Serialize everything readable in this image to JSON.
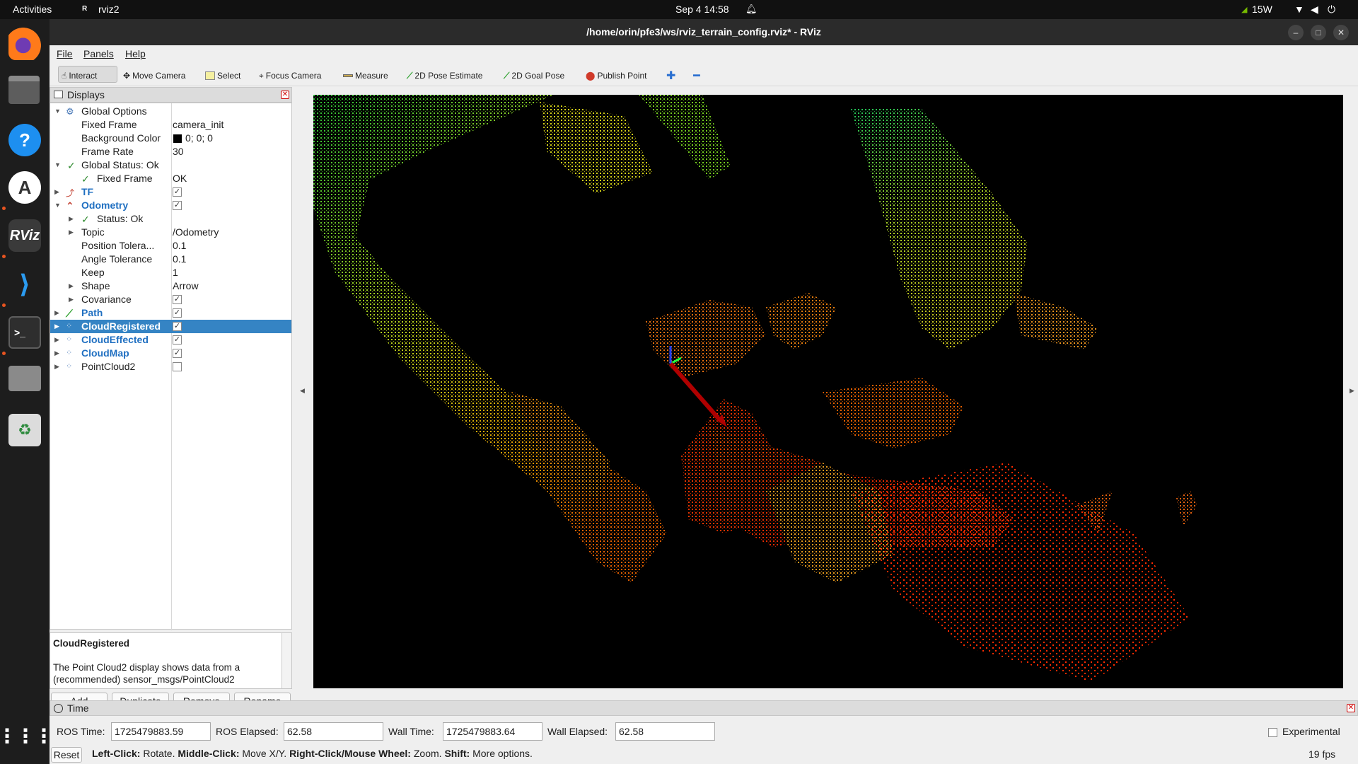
{
  "topbar": {
    "activities": "Activities",
    "app": "rviz2",
    "datetime": "Sep 4  14:58",
    "power": "15W"
  },
  "window": {
    "title": "/home/orin/pfe3/ws/rviz_terrain_config.rviz* - RViz"
  },
  "menu": {
    "file": "File",
    "panels": "Panels",
    "help": "Help"
  },
  "toolbar": {
    "interact": "Interact",
    "move_camera": "Move Camera",
    "select": "Select",
    "focus_camera": "Focus Camera",
    "measure": "Measure",
    "pose_estimate": "2D Pose Estimate",
    "goal_pose": "2D Goal Pose",
    "publish_point": "Publish Point"
  },
  "displays": {
    "title": "Displays",
    "rows": [
      {
        "label": "Global Options",
        "value": ""
      },
      {
        "label": "Fixed Frame",
        "value": "camera_init"
      },
      {
        "label": "Background Color",
        "value": "0; 0; 0"
      },
      {
        "label": "Frame Rate",
        "value": "30"
      },
      {
        "label": "Global Status: Ok",
        "value": ""
      },
      {
        "label": "Fixed Frame",
        "value": "OK"
      },
      {
        "label": "TF",
        "value": ""
      },
      {
        "label": "Odometry",
        "value": ""
      },
      {
        "label": "Status: Ok",
        "value": ""
      },
      {
        "label": "Topic",
        "value": "/Odometry"
      },
      {
        "label": "Position Tolera...",
        "value": "0.1"
      },
      {
        "label": "Angle Tolerance",
        "value": "0.1"
      },
      {
        "label": "Keep",
        "value": "1"
      },
      {
        "label": "Shape",
        "value": "Arrow"
      },
      {
        "label": "Covariance",
        "value": ""
      },
      {
        "label": "Path",
        "value": ""
      },
      {
        "label": "CloudRegistered",
        "value": ""
      },
      {
        "label": "CloudEffected",
        "value": ""
      },
      {
        "label": "CloudMap",
        "value": ""
      },
      {
        "label": "PointCloud2",
        "value": ""
      }
    ],
    "description_title": "CloudRegistered",
    "description_text": "The Point Cloud2 display shows data from a (recommended) sensor_msgs/PointCloud2",
    "buttons": {
      "add": "Add",
      "duplicate": "Duplicate",
      "remove": "Remove",
      "rename": "Rename"
    }
  },
  "time": {
    "title": "Time",
    "ros_time_label": "ROS Time:",
    "ros_time": "1725479883.59",
    "ros_elapsed_label": "ROS Elapsed:",
    "ros_elapsed": "62.58",
    "wall_time_label": "Wall Time:",
    "wall_time": "1725479883.64",
    "wall_elapsed_label": "Wall Elapsed:",
    "wall_elapsed": "62.58",
    "experimental": "Experimental",
    "reset": "Reset",
    "help_1b": "Left-Click:",
    "help_1": " Rotate. ",
    "help_2b": "Middle-Click:",
    "help_2": " Move X/Y. ",
    "help_3b": "Right-Click/Mouse Wheel:",
    "help_3": " Zoom. ",
    "help_4b": "Shift:",
    "help_4": " More options.",
    "fps": "19 fps"
  },
  "colors": {
    "selection": "#3584c4",
    "accent_link": "#1f6fc1",
    "ubuntu_orange": "#e95420"
  }
}
